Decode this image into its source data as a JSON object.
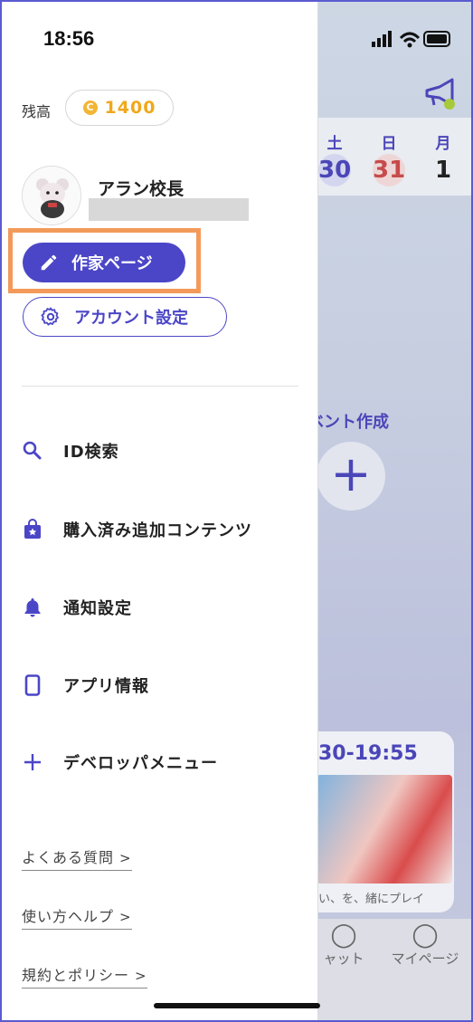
{
  "status": {
    "time": "18:56"
  },
  "balance": {
    "label": "残高",
    "value": "1400",
    "coin_symbol": "C"
  },
  "user": {
    "name": "アラン校長"
  },
  "buttons": {
    "author_page": "作家ページ",
    "account_settings": "アカウント設定"
  },
  "menu": [
    {
      "label": "ID検索",
      "icon": "search-icon"
    },
    {
      "label": "購入済み追加コンテンツ",
      "icon": "shopping-bag-icon"
    },
    {
      "label": "通知設定",
      "icon": "bell-icon"
    },
    {
      "label": "アプリ情報",
      "icon": "phone-icon"
    },
    {
      "label": "デベロッパメニュー",
      "icon": "plus-icon"
    }
  ],
  "links": [
    {
      "label": "よくある質問",
      "chevron": ">"
    },
    {
      "label": "使い方ヘルプ",
      "chevron": ">"
    },
    {
      "label": "規約とポリシー",
      "chevron": ">"
    }
  ],
  "background": {
    "calendar": [
      {
        "dow": "土",
        "day": "30",
        "style": "blue"
      },
      {
        "dow": "日",
        "day": "31",
        "style": "red"
      },
      {
        "dow": "月",
        "day": "1",
        "style": "plain"
      }
    ],
    "event_label": "ベント作成",
    "event_card": {
      "time": "30-19:55",
      "caption": "い、を、緒にプレイ"
    },
    "tabs": [
      {
        "label": "ャット"
      },
      {
        "label": "マイページ"
      }
    ]
  },
  "colors": {
    "accent": "#4b46c7",
    "coin": "#f0a81b",
    "highlight": "#f39a5a"
  }
}
